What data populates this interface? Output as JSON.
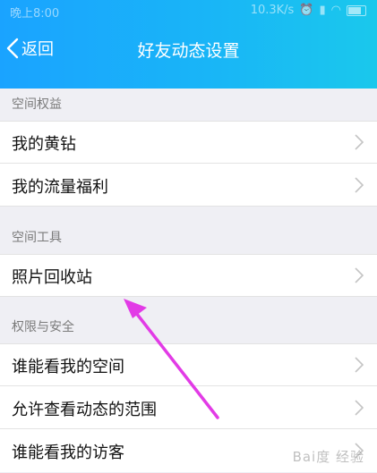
{
  "status_bar": {
    "time": "晚上8:00",
    "network_speed": "10.3K/s"
  },
  "header": {
    "back_label": "返回",
    "title": "好友动态设置"
  },
  "sections": [
    {
      "title": "空间权益",
      "items": [
        "我的黄钻",
        "我的流量福利"
      ]
    },
    {
      "title": "空间工具",
      "items": [
        "照片回收站"
      ]
    },
    {
      "title": "权限与安全",
      "items": [
        "谁能看我的空间",
        "允许查看动态的范围",
        "谁能看我的访客"
      ]
    }
  ],
  "watermark": "Bai度 经验",
  "colors": {
    "header_start": "#1aa3ff",
    "header_end": "#1ac8ec",
    "arrow": "#e23be6",
    "background": "#efeff4"
  },
  "icons": [
    "back-chevron-icon",
    "chevron-right-icon",
    "wifi-icon",
    "signal-icon",
    "battery-icon",
    "alarm-icon"
  ]
}
